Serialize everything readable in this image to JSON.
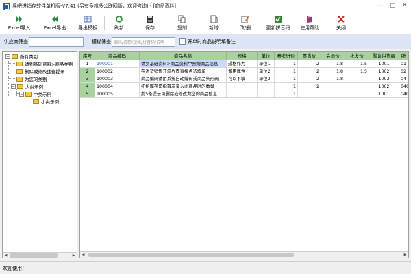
{
  "window": {
    "title": "易吧进销存软件单机版-V7.41 (另有多机多公联网版，欢迎咨询) - [商品资料]",
    "controls": [
      "—",
      "□",
      "✕"
    ]
  },
  "toolbar": {
    "excel_import": "Excel导入",
    "excel_export": "Excel导出",
    "export_template": "导出模板",
    "refresh": "刷新",
    "save": "保存",
    "copy": "复制",
    "add": "新增",
    "edit_delete": "改/删",
    "update_pinyin": "更新拼音码",
    "help": "使用帮助",
    "close": "关闭"
  },
  "filter": {
    "supplier_label": "供应商筛查",
    "fuzzy_label": "模糊筛查",
    "fuzzy_placeholder": "编码/名称/规格/拼音码/说明",
    "notes_label": "开单时商品说明填备注"
  },
  "tree": {
    "root": "所有类别",
    "items": [
      "请到基础资料>商品类别",
      "删除或修改这些提示",
      "为您的类别",
      "大类示例",
      "中类示例",
      "小类示例"
    ]
  },
  "grid": {
    "headers": [
      "序号",
      "商品编码",
      "商品名称",
      "规格",
      "单位",
      "参考进价",
      "零售价",
      "会员价",
      "批发价",
      "默认供货商",
      "所"
    ],
    "rows": [
      {
        "idx": "1",
        "code": "100001",
        "name": "请到基础资料>商品资料中预增商品信息",
        "spec": "规格作为",
        "unit": "单位1",
        "cost": "1",
        "retail": "2",
        "member": "1.8",
        "wholesale": "1.5",
        "supplier": "1001",
        "extra": "01"
      },
      {
        "idx": "2",
        "code": "100002",
        "name": "在进货销售开单界面直接点选填单",
        "spec": "备用属性",
        "unit": "单位2",
        "cost": "1",
        "retail": "2",
        "member": "1.8",
        "wholesale": "1.5",
        "supplier": "1002",
        "extra": "02"
      },
      {
        "idx": "3",
        "code": "100003",
        "name": "商品编码请用系统自动编码或商品条形码",
        "spec": "可以不填",
        "unit": "单位3",
        "cost": "1",
        "retail": "2",
        "member": "1.8",
        "wholesale": "",
        "supplier": "1003",
        "extra": "04"
      },
      {
        "idx": "4",
        "code": "100004",
        "name": "初始库存是指首次录入此商品时的数量",
        "spec": "",
        "unit": "",
        "cost": "1",
        "retail": "2",
        "member": "",
        "wholesale": "",
        "supplier": "1002",
        "extra": "040"
      },
      {
        "idx": "5",
        "code": "100005",
        "name": "此5条提示可删除或修改为您的商品信息",
        "spec": "",
        "unit": "",
        "cost": "1",
        "retail": "",
        "member": "",
        "wholesale": "",
        "supplier": "1001",
        "extra": "040"
      }
    ]
  },
  "status": {
    "text": "欢迎使用！"
  },
  "colors": {
    "grid_header": "#a9d2a0",
    "filter_bar": "#dce6f4",
    "selection": "#ccd9ff",
    "code_text": "#1a55c8"
  },
  "icons": [
    "excel-import-icon",
    "excel-export-icon",
    "export-template-icon",
    "refresh-icon",
    "save-icon",
    "copy-icon",
    "add-icon",
    "edit-icon",
    "pinyin-icon",
    "help-book-icon",
    "close-x-icon"
  ]
}
